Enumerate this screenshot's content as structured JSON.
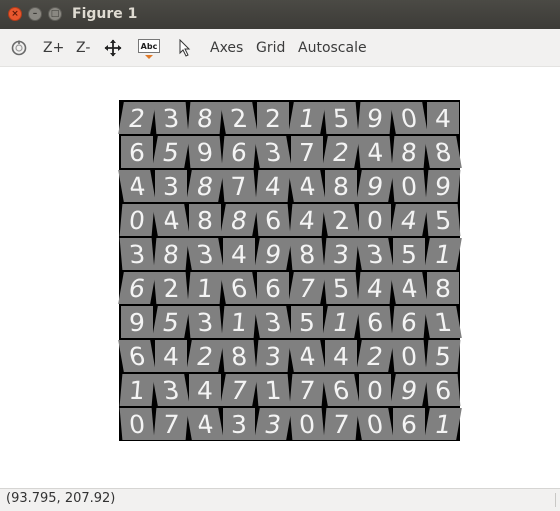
{
  "window": {
    "title": "Figure 1",
    "close_glyph": "×",
    "minimize_glyph": "–",
    "maximize_glyph": "□"
  },
  "toolbar": {
    "home_icon": "home-icon",
    "zoom_in_label": "Z+",
    "zoom_out_label": "Z-",
    "pan_icon": "pan-icon",
    "insert_text_label": "Abc",
    "pointer_icon": "pointer-icon",
    "axes_label": "Axes",
    "grid_label": "Grid",
    "autoscale_label": "Autoscale"
  },
  "figure": {
    "digits": [
      [
        "2",
        "3",
        "8",
        "2",
        "2",
        "1",
        "5",
        "9",
        "0",
        "4"
      ],
      [
        "6",
        "5",
        "9",
        "6",
        "3",
        "7",
        "2",
        "4",
        "8",
        "8"
      ],
      [
        "4",
        "3",
        "8",
        "7",
        "4",
        "4",
        "8",
        "9",
        "0",
        "9"
      ],
      [
        "0",
        "4",
        "8",
        "8",
        "6",
        "4",
        "2",
        "0",
        "4",
        "5"
      ],
      [
        "3",
        "8",
        "3",
        "4",
        "9",
        "8",
        "3",
        "3",
        "5",
        "1"
      ],
      [
        "6",
        "2",
        "1",
        "6",
        "6",
        "7",
        "5",
        "4",
        "4",
        "8"
      ],
      [
        "9",
        "5",
        "3",
        "1",
        "3",
        "5",
        "1",
        "6",
        "6",
        "1"
      ],
      [
        "6",
        "4",
        "2",
        "8",
        "3",
        "4",
        "4",
        "2",
        "0",
        "5"
      ],
      [
        "1",
        "3",
        "4",
        "7",
        "1",
        "7",
        "6",
        "0",
        "9",
        "6"
      ],
      [
        "0",
        "7",
        "4",
        "3",
        "3",
        "0",
        "7",
        "0",
        "6",
        "1"
      ]
    ],
    "cell_background": "#808080",
    "stroke_color": "#f4f4f4",
    "separator_color": "#000000"
  },
  "status": {
    "coordinates": "(93.795, 207.92)"
  },
  "colors": {
    "titlebar": "#3c3b37",
    "close_button": "#e8572e",
    "toolbar_bg": "#f2f1f0"
  }
}
